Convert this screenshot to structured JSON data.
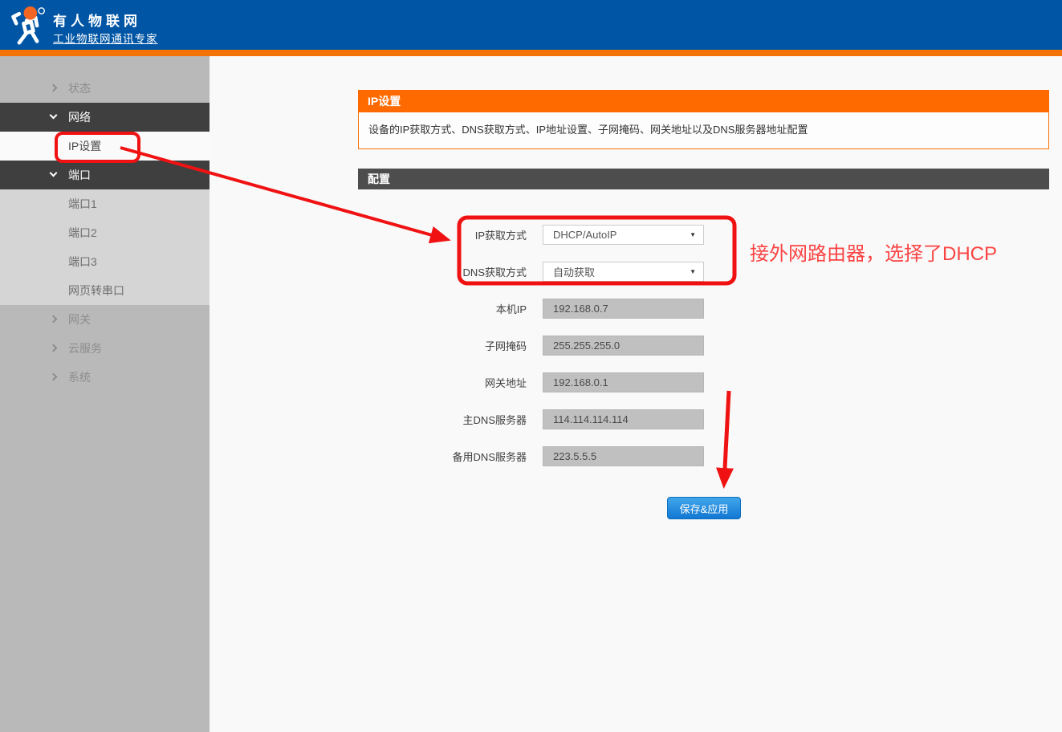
{
  "header": {
    "title": "有人物联网",
    "subtitle": "工业物联网通讯专家",
    "logo_icon": "person-figure-icon"
  },
  "sidebar": {
    "items": [
      {
        "label": "状态",
        "type": "group",
        "chevron": "right"
      },
      {
        "label": "网络",
        "type": "open",
        "chevron": "down"
      },
      {
        "label": "IP设置",
        "type": "active"
      },
      {
        "label": "端口",
        "type": "open",
        "chevron": "down"
      },
      {
        "label": "端口1",
        "type": "sub"
      },
      {
        "label": "端口2",
        "type": "sub"
      },
      {
        "label": "端口3",
        "type": "sub"
      },
      {
        "label": "网页转串口",
        "type": "sub"
      },
      {
        "label": "网关",
        "type": "group",
        "chevron": "right"
      },
      {
        "label": "云服务",
        "type": "group",
        "chevron": "right"
      },
      {
        "label": "系统",
        "type": "group",
        "chevron": "right"
      }
    ]
  },
  "main": {
    "panel_title": "IP设置",
    "panel_description": "设备的IP获取方式、DNS获取方式、IP地址设置、子网掩码、网关地址以及DNS服务器地址配置",
    "section_title": "配置",
    "form": {
      "fields": [
        {
          "label": "IP获取方式",
          "value": "DHCP/AutoIP",
          "type": "select"
        },
        {
          "label": "DNS获取方式",
          "value": "自动获取",
          "type": "select"
        },
        {
          "label": "本机IP",
          "value": "192.168.0.7",
          "type": "text"
        },
        {
          "label": "子网掩码",
          "value": "255.255.255.0",
          "type": "text"
        },
        {
          "label": "网关地址",
          "value": "192.168.0.1",
          "type": "text"
        },
        {
          "label": "主DNS服务器",
          "value": "114.114.114.114",
          "type": "text"
        },
        {
          "label": "备用DNS服务器",
          "value": "223.5.5.5",
          "type": "text"
        }
      ],
      "save_button": "保存&应用"
    }
  },
  "annotations": {
    "note_text": "接外网路由器，选择了DHCP"
  },
  "icons": {
    "select_caret": "▼"
  },
  "colors": {
    "header_blue": "#0055a5",
    "accent_orange": "#f57206",
    "panel_orange": "#ff6a00",
    "section_gray": "#4d4d4d",
    "button_blue": "#1277d3",
    "annotation_red": "#f01212",
    "annotation_text_red": "#fb4343"
  }
}
